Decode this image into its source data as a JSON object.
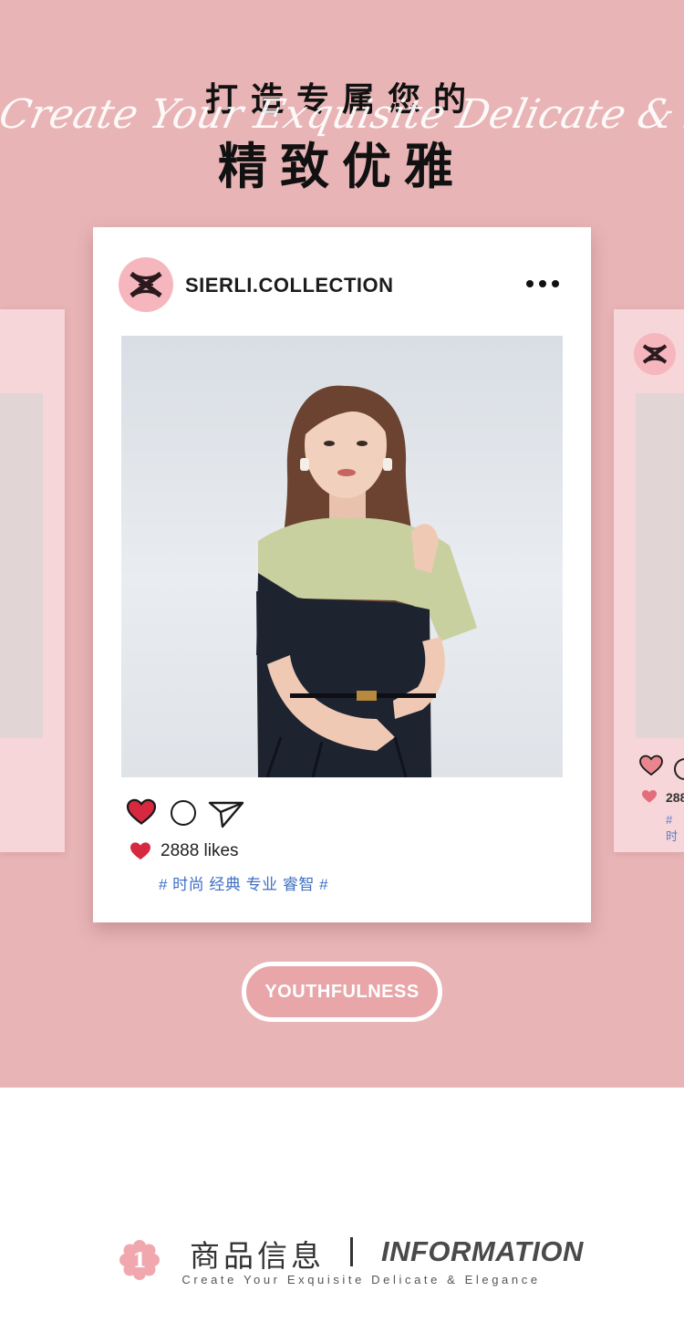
{
  "colors": {
    "hero_bg": "#e8b4b6",
    "card_bg": "#ffffff",
    "side_card_bg": "#f6d6d8",
    "heart_red": "#d6283f",
    "tag_blue": "#3f6fc4",
    "avatar_pink": "#f5b7bd",
    "pill_fill": "#e8a6a9"
  },
  "header": {
    "title_top": "打造专属您的",
    "script_text": "Create Your Exquisite Delicate & Elegance",
    "title_main": "精致优雅"
  },
  "post": {
    "brand_name": "SIERLI.COLLECTION",
    "avatar_icon": "brand-logo-icon",
    "more_icon": "more-dots-icon",
    "actions": [
      "heart-icon",
      "comment-icon",
      "send-icon"
    ],
    "likes": "2888 likes",
    "tags": "# 时尚 经典 专业 睿智 #"
  },
  "side_cards": {
    "right_likes": "288",
    "right_tag": "# 时"
  },
  "pill_button": {
    "label": "YOUTHFULNESS"
  },
  "section": {
    "badge_number": "1",
    "title_cn": "商品信息",
    "title_en": "INFORMATION",
    "subtitle": "Create Your Exquisite Delicate & Elegance"
  }
}
